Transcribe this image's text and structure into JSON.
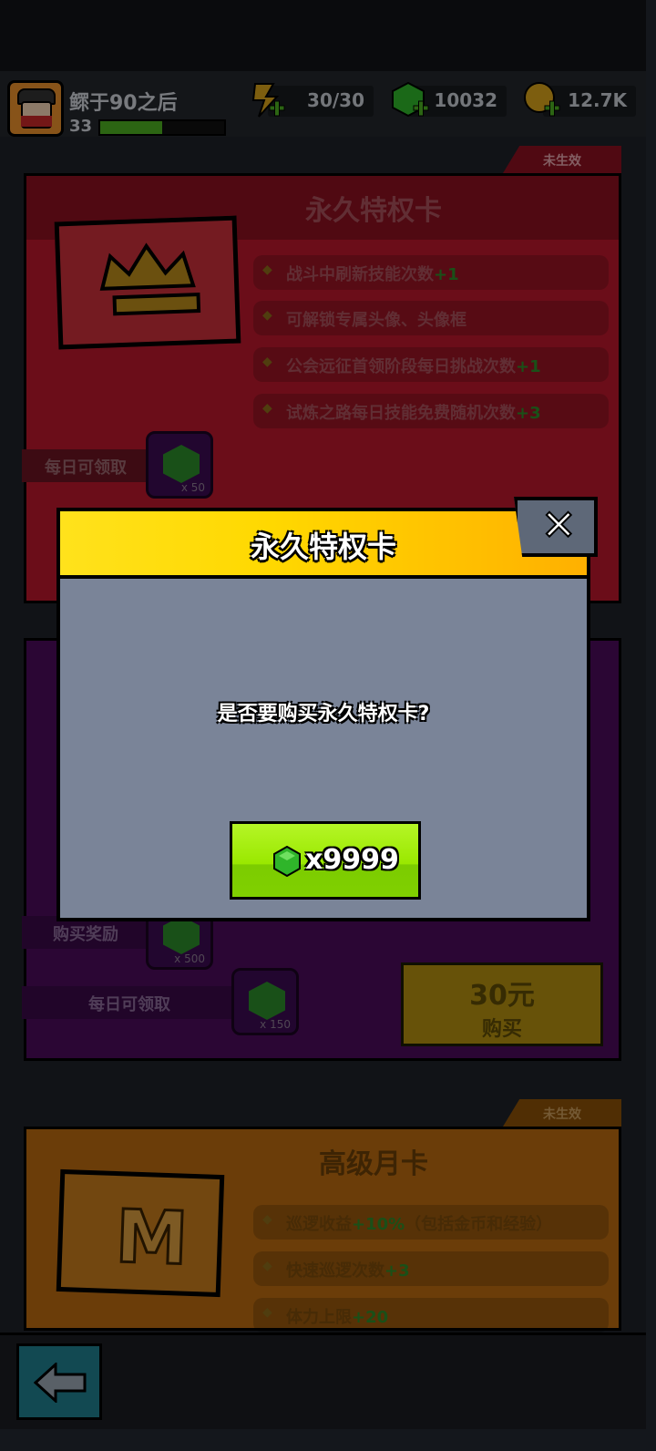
{
  "player": {
    "name": "鳏于90之后",
    "level": "33",
    "xp_fraction": 0.5
  },
  "resources": [
    {
      "id": "energy",
      "value": "30/30"
    },
    {
      "id": "gems",
      "value": "10032"
    },
    {
      "id": "coins",
      "value": "12.7K"
    }
  ],
  "cards": {
    "permanent": {
      "status": "未生效",
      "title": "永久特权卡",
      "features": [
        {
          "text": "战斗中刷新技能次数",
          "bonus": "+1"
        },
        {
          "text": "可解锁专属头像、头像框",
          "bonus": ""
        },
        {
          "text": "公会远征首领阶段每日挑战次数",
          "bonus": "+1"
        },
        {
          "text": "试炼之路每日技能免费随机次数",
          "bonus": "+3"
        }
      ],
      "daily_label": "每日可领取",
      "daily_count": "x 50"
    },
    "purple": {
      "purchase_label": "购买奖励",
      "purchase_count": "x 500",
      "daily_label": "每日可领取",
      "daily_count": "x 150",
      "price": "30元",
      "buy_label": "购买"
    },
    "monthly": {
      "status": "未生效",
      "title": "高级月卡",
      "icon_letter": "M",
      "features": [
        {
          "text": "巡逻收益",
          "bonus": "+10%",
          "suffix": "（包括金币和经验）"
        },
        {
          "text": "快速巡逻次数",
          "bonus": "+3",
          "suffix": ""
        },
        {
          "text": "体力上限",
          "bonus": "+20",
          "suffix": ""
        }
      ]
    }
  },
  "modal": {
    "title": "永久特权卡",
    "question": "是否要购买永久特权卡?",
    "price": "x9999"
  },
  "colors": {
    "accent_yellow": "#ffd800",
    "buy_green": "#9ae800",
    "gem_green": "#2fb52a"
  }
}
